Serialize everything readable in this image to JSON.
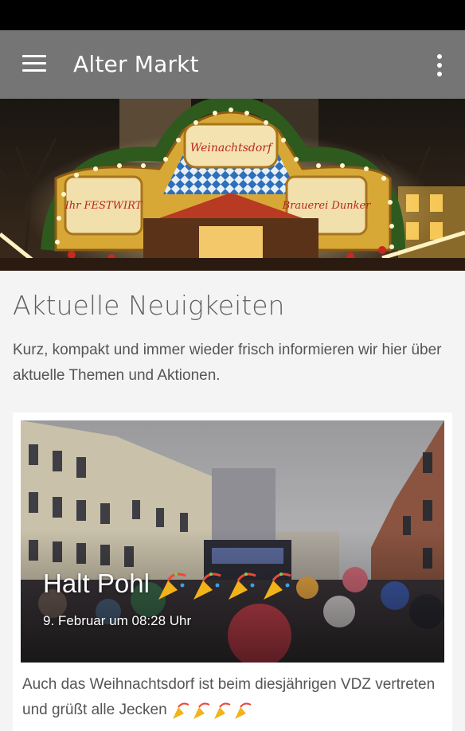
{
  "app_bar": {
    "title": "Alter Markt",
    "menu_icon": "hamburger-menu-icon",
    "overflow_icon": "more-vert-icon",
    "background": "#757575"
  },
  "hero": {
    "signs": {
      "top_main": "Weinachtsdorf",
      "left": "Ihr FESTWIRT",
      "right": "Brauerei Dunker"
    }
  },
  "section": {
    "title": "Aktuelle Neuigkeiten",
    "intro": "Kurz, kompakt und immer wieder frisch informieren wir hier über aktuelle Themen und Aktionen."
  },
  "post": {
    "headline": "Halt Pohl",
    "headline_emoji": "party-popper-icon",
    "date": "9. Februar um 08:28 Uhr",
    "text": "Auch das Weihnachtsdorf ist beim diesjährigen VDZ vertreten und grüßt alle Jecken",
    "text_emoji": "party-popper-icon"
  }
}
